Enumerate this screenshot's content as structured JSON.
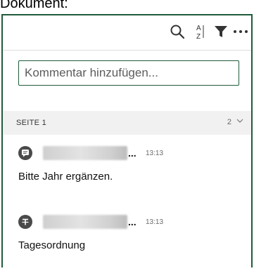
{
  "header": {
    "label": "Dokument:"
  },
  "toolbar": {
    "icons": [
      "search-icon",
      "sort-az-icon",
      "filter-icon",
      "more-icon"
    ]
  },
  "comment_input": {
    "placeholder": "Kommentar hinzufügen..."
  },
  "section": {
    "title": "SEITE 1",
    "count": "2"
  },
  "comments": [
    {
      "author": "",
      "ellipsis": "...",
      "time": "13:13",
      "text": "Bitte Jahr ergänzen.",
      "icon": "comment-icon"
    },
    {
      "author": "",
      "ellipsis": "...",
      "time": "13:13",
      "text": "Tagesordnung",
      "icon": "strikethrough-icon"
    }
  ],
  "colors": {
    "accent": "#1f5b3a",
    "section_bg": "#f1f1f1",
    "avatar_bg": "#4a4a4a"
  }
}
